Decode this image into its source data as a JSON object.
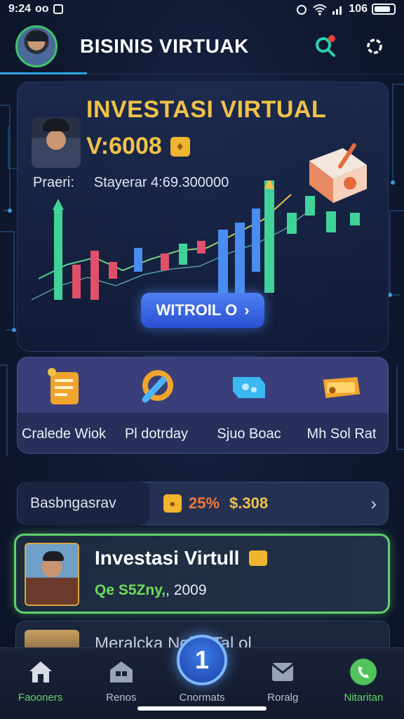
{
  "status_bar": {
    "time": "9:24",
    "left_extra": "oo",
    "right_text": "106"
  },
  "header": {
    "title": "BISINIS VIRTUAK",
    "icons": [
      "search-icon",
      "settings-icon"
    ]
  },
  "hero": {
    "title": "INVESTASI VIRTUAL",
    "amount": "V:6008",
    "price_label": "Praeri:",
    "price_value": "Stayerar 4:69.300000",
    "button_label": "WITROIL O",
    "button_arrow": "›"
  },
  "actions": [
    {
      "label": "Cralede Wiok",
      "icon": "clipboard-icon"
    },
    {
      "label": "Pl dotrday",
      "icon": "link-icon"
    },
    {
      "label": "Sjuo Boac",
      "icon": "ticket-icon"
    },
    {
      "label": "Mh Sol Rat",
      "icon": "wallet-icon"
    }
  ],
  "ticker": {
    "label": "Basbngasrav",
    "percent": "25%",
    "value": "$.308",
    "arrow": "›"
  },
  "featured": {
    "title": "Investasi Virtull",
    "sub_green": "Qe S5Zny,",
    "sub_white": ", 2009"
  },
  "partial_card": {
    "title": "Meralcka Nohe Tal ol"
  },
  "bottom_nav": {
    "items": [
      {
        "label": "Faooners",
        "icon": "home-icon"
      },
      {
        "label": "Renos",
        "icon": "house-grid-icon"
      },
      {
        "label": "Cnormats",
        "icon": "center-action-icon"
      },
      {
        "label": "Roralg",
        "icon": "mail-icon"
      },
      {
        "label": "Nitaritan",
        "icon": "phone-icon"
      }
    ],
    "center_glyph": "1"
  },
  "colors": {
    "accent_gold": "#f0c24a",
    "accent_green": "#5fd36a",
    "accent_blue": "#3a66e0",
    "background": "#111a33"
  }
}
